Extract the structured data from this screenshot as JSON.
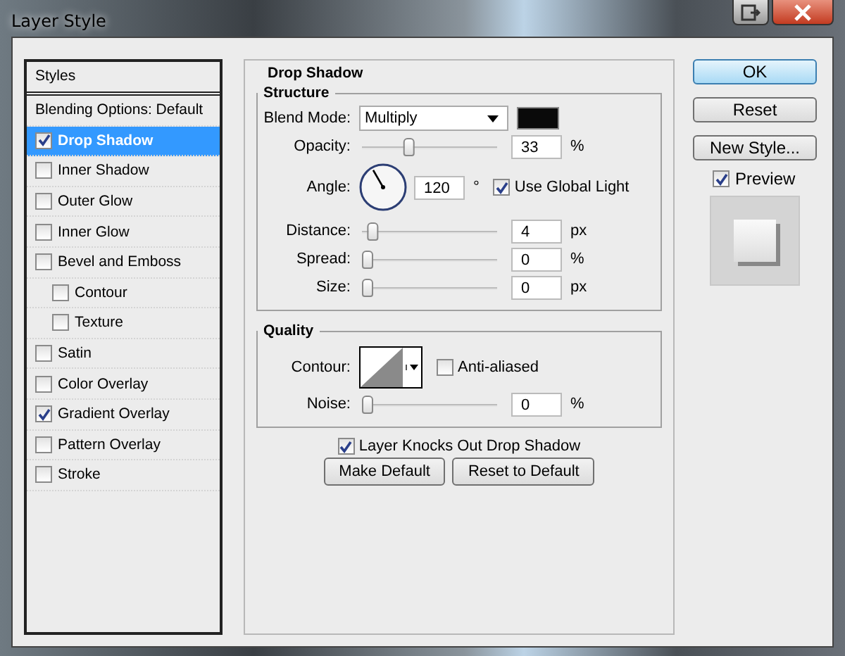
{
  "window": {
    "title": "Layer Style"
  },
  "styles": {
    "header": "Styles",
    "items": [
      {
        "kind": "plain",
        "label": "Blending Options: Default",
        "selected": false
      },
      {
        "kind": "check",
        "label": "Drop Shadow",
        "checked": true,
        "selected": true
      },
      {
        "kind": "check",
        "label": "Inner Shadow",
        "checked": false,
        "selected": false
      },
      {
        "kind": "check",
        "label": "Outer Glow",
        "checked": false,
        "selected": false
      },
      {
        "kind": "check",
        "label": "Inner Glow",
        "checked": false,
        "selected": false
      },
      {
        "kind": "check",
        "label": "Bevel and Emboss",
        "checked": false,
        "selected": false,
        "children": [
          {
            "kind": "check",
            "label": "Contour",
            "checked": false,
            "selected": false
          },
          {
            "kind": "check",
            "label": "Texture",
            "checked": false,
            "selected": false
          }
        ]
      },
      {
        "kind": "check",
        "label": "Satin",
        "checked": false,
        "selected": false
      },
      {
        "kind": "check",
        "label": "Color Overlay",
        "checked": false,
        "selected": false
      },
      {
        "kind": "check",
        "label": "Gradient Overlay",
        "checked": true,
        "selected": false
      },
      {
        "kind": "check",
        "label": "Pattern Overlay",
        "checked": false,
        "selected": false
      },
      {
        "kind": "check",
        "label": "Stroke",
        "checked": false,
        "selected": false
      }
    ]
  },
  "panel": {
    "title": "Drop Shadow",
    "structure": {
      "title": "Structure",
      "blend_mode": {
        "label": "Blend Mode:",
        "value": "Multiply"
      },
      "opacity": {
        "label": "Opacity:",
        "level": 0.33,
        "value": "33",
        "unit": "%"
      },
      "angle": {
        "label": "Angle:",
        "value": "120",
        "unit": "°",
        "global_light": {
          "label": "Use Global Light",
          "checked": true
        }
      },
      "sliders": [
        {
          "label": "Distance:",
          "level": 0.04,
          "value": "4",
          "unit": "px"
        },
        {
          "label": "Spread:",
          "level": 0,
          "value": "0",
          "unit": "%"
        },
        {
          "label": "Size:",
          "level": 0,
          "value": "0",
          "unit": "px"
        }
      ]
    },
    "quality": {
      "title": "Quality",
      "contour_label": "Contour:",
      "anti_aliased": {
        "label": "Anti-aliased",
        "checked": false
      },
      "noise": {
        "label": "Noise:",
        "level": 0,
        "value": "0",
        "unit": "%"
      }
    },
    "knockout": {
      "label": "Layer Knocks Out Drop Shadow",
      "checked": true
    },
    "buttons": [
      "Make Default",
      "Reset to Default"
    ]
  },
  "side": {
    "buttons": [
      {
        "label": "OK",
        "kind": "default"
      },
      {
        "label": "Reset",
        "kind": "normal"
      },
      {
        "label": "New Style...",
        "kind": "normal"
      }
    ],
    "preview": {
      "label": "Preview",
      "checked": true
    }
  }
}
